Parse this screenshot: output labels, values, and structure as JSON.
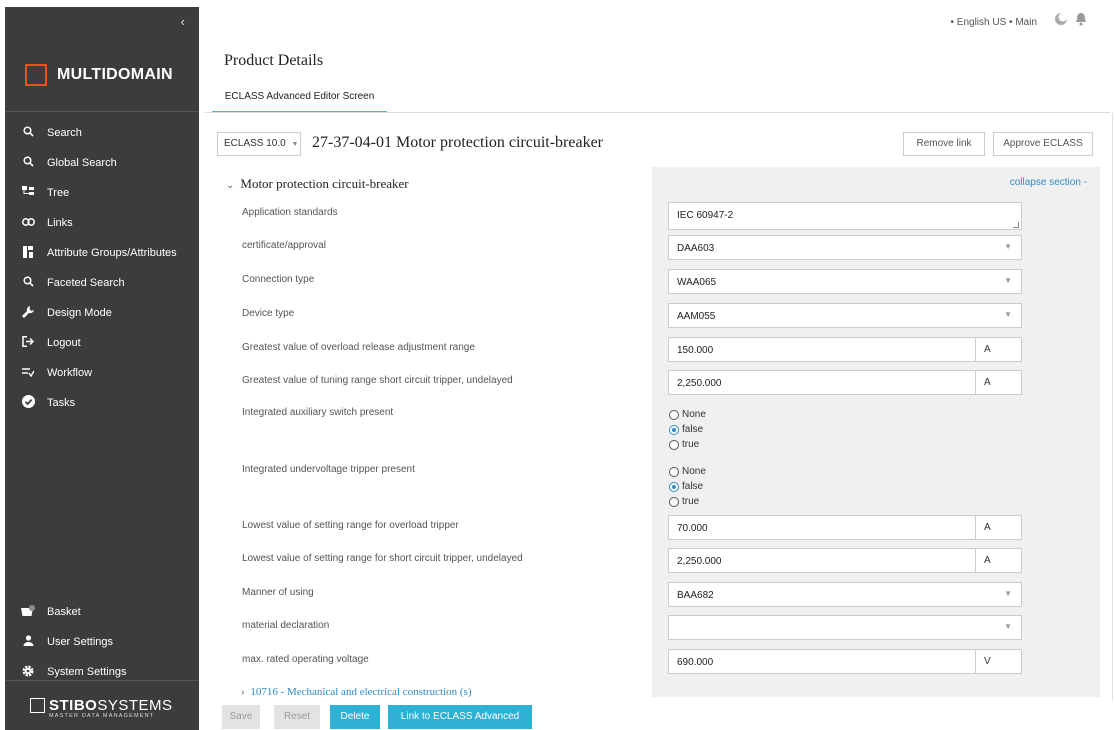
{
  "sidebar": {
    "collapse_glyph": "‹",
    "logo_text": "MULTIDOMAIN",
    "nav": [
      {
        "icon": "search-icon",
        "glyph": "⚲",
        "label": "Search"
      },
      {
        "icon": "search-icon",
        "glyph": "⚲",
        "label": "Global Search"
      },
      {
        "icon": "tree-icon",
        "glyph": "⊤",
        "label": "Tree"
      },
      {
        "icon": "link-icon",
        "glyph": "∞",
        "label": "Links"
      },
      {
        "icon": "attribute-icon",
        "glyph": "▮",
        "label": "Attribute Groups/Attributes"
      },
      {
        "icon": "search-icon",
        "glyph": "⚲",
        "label": "Faceted Search"
      },
      {
        "icon": "wrench-icon",
        "glyph": "✎",
        "label": "Design Mode"
      },
      {
        "icon": "logout-icon",
        "glyph": "⇥",
        "label": "Logout"
      },
      {
        "icon": "workflow-icon",
        "glyph": "≡",
        "label": "Workflow"
      },
      {
        "icon": "check-circle-icon",
        "glyph": "✔",
        "label": "Tasks"
      }
    ],
    "bottom": [
      {
        "icon": "basket-icon",
        "glyph": "🧺",
        "label": "Basket",
        "badge": "0"
      },
      {
        "icon": "user-icon",
        "glyph": "●",
        "label": "User Settings"
      },
      {
        "icon": "gear-icon",
        "glyph": "⚙",
        "label": "System Settings"
      }
    ],
    "brand_bold": "STIBO",
    "brand_thin": "SYSTEMS",
    "brand_sub": "MASTER DATA MANAGEMENT"
  },
  "topbar": {
    "locale": "• English US • Main",
    "theme_icon": "theme-icon",
    "bell_icon": "bell-icon"
  },
  "page": {
    "title": "Product Details",
    "tab": "ECLASS Advanced Editor Screen"
  },
  "header": {
    "version_select": "ECLASS 10.0",
    "product_title": "27-37-04-01 Motor protection circuit-breaker",
    "remove_link": "Remove link",
    "approve": "Approve ECLASS"
  },
  "section": {
    "title": "Motor protection circuit-breaker",
    "collapse": "collapse section -"
  },
  "attributes": [
    {
      "label": "Application standards",
      "value": "IEC 60947-2",
      "kind": "textarea"
    },
    {
      "label": "certificate/approval",
      "value": "DAA603",
      "kind": "select"
    },
    {
      "label": "Connection type",
      "value": "WAA065",
      "kind": "select"
    },
    {
      "label": "Device type",
      "value": "AAM055",
      "kind": "select"
    },
    {
      "label": "Greatest value of overload release adjustment range",
      "value": "150.000",
      "unit": "A",
      "kind": "unit"
    },
    {
      "label": "Greatest value of tuning range short circuit tripper, undelayed",
      "value": "2,250.000",
      "unit": "A",
      "kind": "unit"
    },
    {
      "label": "Integrated auxiliary switch present",
      "kind": "radio",
      "options": [
        "None",
        "false",
        "true"
      ],
      "selected": "false"
    },
    {
      "label": "Integrated undervoltage tripper present",
      "kind": "radio",
      "options": [
        "None",
        "false",
        "true"
      ],
      "selected": "false"
    },
    {
      "label": "Lowest value of setting range for overload tripper",
      "value": "70.000",
      "unit": "A",
      "kind": "unit"
    },
    {
      "label": "Lowest value of setting range for short circuit tripper, undelayed",
      "value": "2,250.000",
      "unit": "A",
      "kind": "unit"
    },
    {
      "label": "Manner of using",
      "value": "BAA682",
      "kind": "select"
    },
    {
      "label": "material declaration",
      "value": "",
      "kind": "select"
    },
    {
      "label": "max. rated operating voltage",
      "value": "690.000",
      "unit": "V",
      "kind": "unit"
    }
  ],
  "subsection": "10716 - Mechanical and electrical construction (s)",
  "footer": {
    "save": "Save",
    "reset": "Reset",
    "delete": "Delete",
    "link": "Link to ECLASS Advanced"
  },
  "colors": {
    "accent": "#2fb0d6",
    "link": "#2d8cc6",
    "logo_orange": "#e8541e",
    "sidebar_bg": "#3c3c3c"
  }
}
